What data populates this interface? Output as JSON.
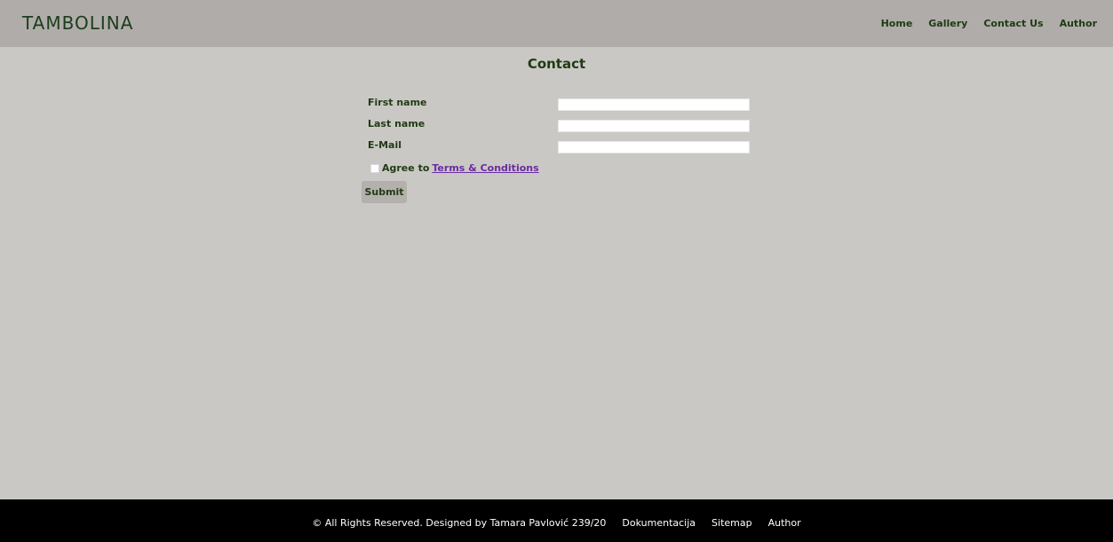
{
  "header": {
    "logo_text": "TAMBOLINA",
    "nav": [
      {
        "label": "Home"
      },
      {
        "label": "Gallery"
      },
      {
        "label": "Contact Us"
      },
      {
        "label": "Author"
      }
    ]
  },
  "main": {
    "title": "Contact",
    "form": {
      "fields": [
        {
          "label": "First name",
          "value": ""
        },
        {
          "label": "Last name",
          "value": ""
        },
        {
          "label": "E-Mail",
          "value": ""
        }
      ],
      "agree_prefix": "Agree to",
      "terms_link_label": "Terms & Conditions",
      "submit_label": "Submit"
    }
  },
  "footer": {
    "copyright": "© All Rights Reserved. Designed by Tamara Pavlović 239/20",
    "links": [
      {
        "label": "Dokumentacija"
      },
      {
        "label": "Sitemap"
      },
      {
        "label": "Author"
      }
    ]
  },
  "colors": {
    "background": "#cac8c5",
    "header_background": "#afaca9",
    "footer_background": "#000000",
    "text_primary": "#1f3b12",
    "link": "#6a2ca2"
  }
}
